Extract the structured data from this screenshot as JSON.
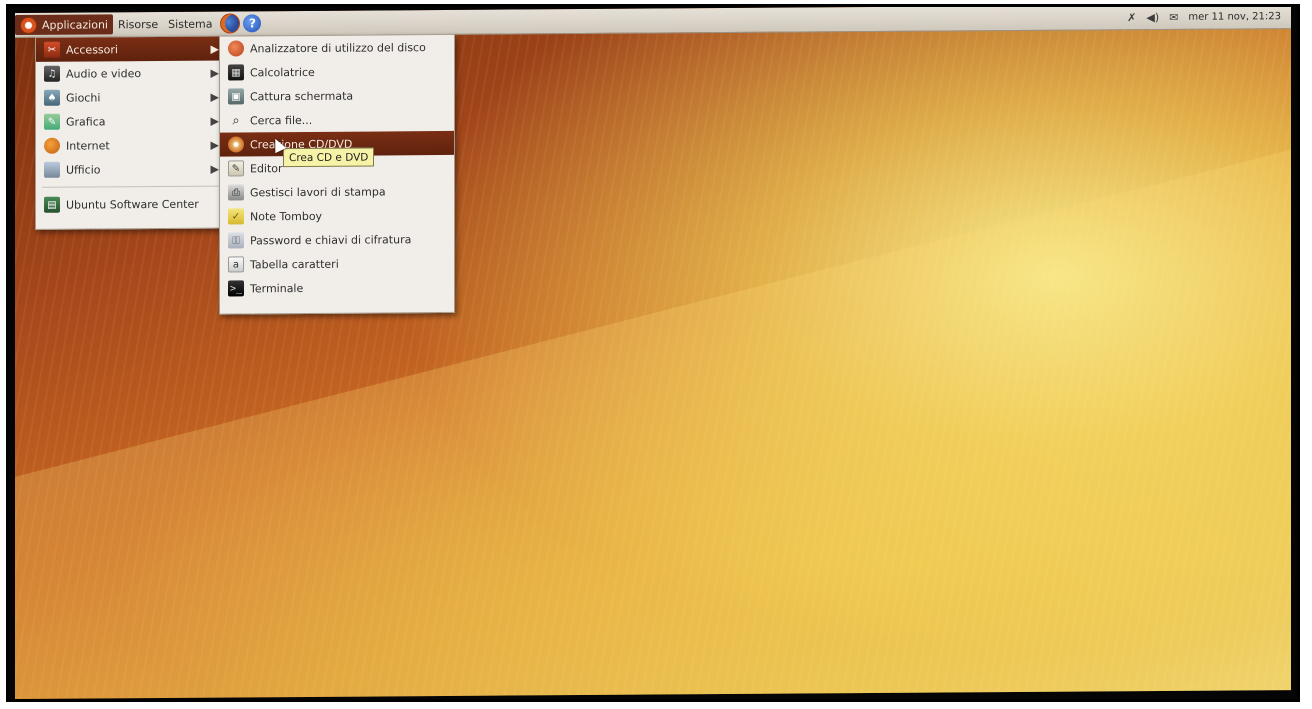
{
  "panel": {
    "menus": [
      {
        "label": "Applicazioni"
      },
      {
        "label": "Risorse"
      },
      {
        "label": "Sistema"
      }
    ],
    "clock": "mer 11 nov, 21:23"
  },
  "main_menu": {
    "items": [
      {
        "label": "Accessori"
      },
      {
        "label": "Audio e video"
      },
      {
        "label": "Giochi"
      },
      {
        "label": "Grafica"
      },
      {
        "label": "Internet"
      },
      {
        "label": "Ufficio"
      }
    ],
    "software_center": "Ubuntu Software Center"
  },
  "submenu": {
    "items": [
      {
        "label": "Analizzatore di utilizzo del disco"
      },
      {
        "label": "Calcolatrice"
      },
      {
        "label": "Cattura schermata"
      },
      {
        "label": "Cerca file..."
      },
      {
        "label": "Creazione CD/DVD"
      },
      {
        "label": "Editor"
      },
      {
        "label": "Gestisci lavori di stampa"
      },
      {
        "label": "Note Tomboy"
      },
      {
        "label": "Password e chiavi di cifratura"
      },
      {
        "label": "Tabella caratteri"
      },
      {
        "label": "Terminale"
      }
    ]
  },
  "tooltip": "Crea CD e DVD",
  "colors": {
    "highlight": "#6b2d19",
    "menu_bg": "#f1eee9",
    "tooltip_bg": "#f7f3a6"
  }
}
